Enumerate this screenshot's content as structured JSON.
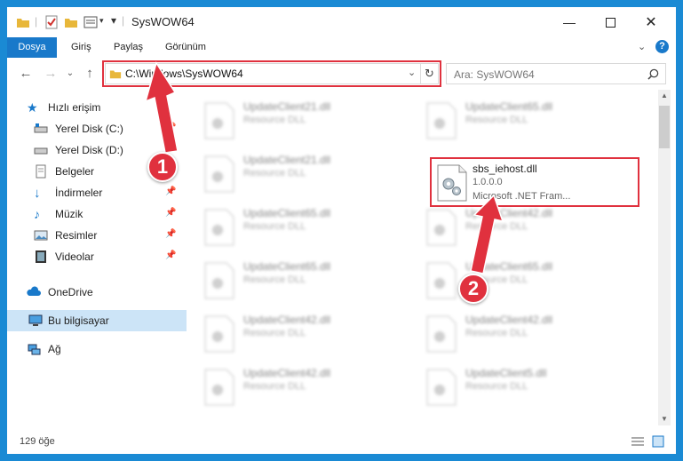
{
  "window": {
    "title": "SysWOW64"
  },
  "ribbon": {
    "tabs": [
      "Dosya",
      "Giriş",
      "Paylaş",
      "Görünüm"
    ]
  },
  "nav": {
    "address": "C:\\Windows\\SysWOW64",
    "search_placeholder": "Ara: SysWOW64"
  },
  "sidebar": {
    "items": [
      {
        "label": "Hızlı erişim",
        "icon": "star-icon"
      },
      {
        "label": "Yerel Disk (C:)",
        "icon": "drive-icon"
      },
      {
        "label": "Yerel Disk (D:)",
        "icon": "drive-icon"
      },
      {
        "label": "Belgeler",
        "icon": "documents-icon"
      },
      {
        "label": "İndirmeler",
        "icon": "download-icon"
      },
      {
        "label": "Müzik",
        "icon": "music-icon"
      },
      {
        "label": "Resimler",
        "icon": "pictures-icon"
      },
      {
        "label": "Videolar",
        "icon": "video-icon"
      },
      {
        "label": "OneDrive",
        "icon": "cloud-icon"
      },
      {
        "label": "Bu bilgisayar",
        "icon": "computer-icon"
      },
      {
        "label": "Ağ",
        "icon": "network-icon"
      }
    ]
  },
  "files": {
    "left": [
      {
        "name": "UpdateClient21.dll",
        "desc": "Resource DLL"
      },
      {
        "name": "UpdateClient21.dll",
        "desc": "Resource DLL"
      },
      {
        "name": "UpdateClient65.dll",
        "desc": "Resource DLL"
      },
      {
        "name": "UpdateClient65.dll",
        "desc": "Resource DLL"
      },
      {
        "name": "UpdateClient42.dll",
        "desc": "Resource DLL"
      },
      {
        "name": "UpdateClient42.dll",
        "desc": "Resource DLL"
      }
    ],
    "right": [
      {
        "name": "UpdateClient65.dll",
        "desc": "Resource DLL"
      },
      {
        "name": "UpdateClient42.dll",
        "desc": "Resource DLL"
      },
      {
        "name": "UpdateClient65.dll",
        "desc": "Resource DLL"
      },
      {
        "name": "UpdateClient42.dll",
        "desc": "Resource DLL"
      },
      {
        "name": "UpdateClient5.dll",
        "desc": "Resource DLL"
      }
    ],
    "highlighted": {
      "name": "sbs_iehost.dll",
      "version": "1.0.0.0",
      "company": "Microsoft .NET Fram..."
    }
  },
  "status": {
    "count": "129 öğe"
  },
  "annotations": {
    "step1": "1",
    "step2": "2"
  },
  "colors": {
    "accent": "#1979ca",
    "callout": "#e0313e",
    "selected": "#cce4f7"
  }
}
